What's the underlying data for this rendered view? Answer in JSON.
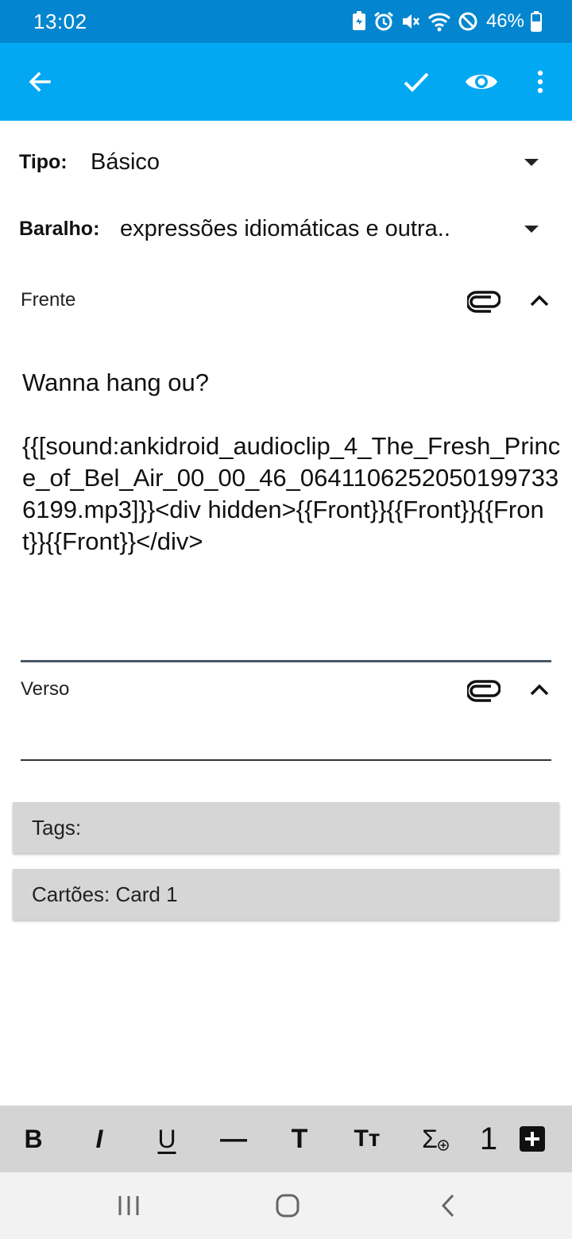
{
  "status_bar": {
    "time": "13:02",
    "battery": "46%",
    "icons": [
      "battery-saver-icon",
      "alarm-icon",
      "mute-icon",
      "wifi-icon",
      "do-not-disturb-icon",
      "battery-icon"
    ]
  },
  "toolbar": {
    "back": "back-arrow-icon",
    "actions": [
      "check-icon",
      "preview-eye-icon",
      "more-vert-icon"
    ]
  },
  "note_type": {
    "label": "Tipo:",
    "value": "Básico"
  },
  "deck": {
    "label": "Baralho:",
    "value": "expressões idiomáticas e outra.."
  },
  "fields": [
    {
      "label": "Frente",
      "content": "Wanna hang ou?\n\n{{[sound:ankidroid_audioclip_4_The_Fresh_Prince_of_Bel_Air_00_00_46_06411062520501997336199.mp3]}}<div hidden>{{Front}}{{Front}}{{Front}}{{Front}}</div>"
    },
    {
      "label": "Verso",
      "content": ""
    }
  ],
  "tags": {
    "label": "Tags:"
  },
  "cards": {
    "label": "Cartões: Card 1"
  },
  "format_toolbar": {
    "bold": "B",
    "italic": "I",
    "underline": "U",
    "hr": "—",
    "title": "T",
    "font_size": "Tт",
    "mathjax": "Σ",
    "cloze": "1"
  },
  "colors": {
    "status_bar": "#0386cf",
    "toolbar": "#03a8f2",
    "format_bar": "#d4d4d4",
    "box": "#d6d6d6"
  }
}
